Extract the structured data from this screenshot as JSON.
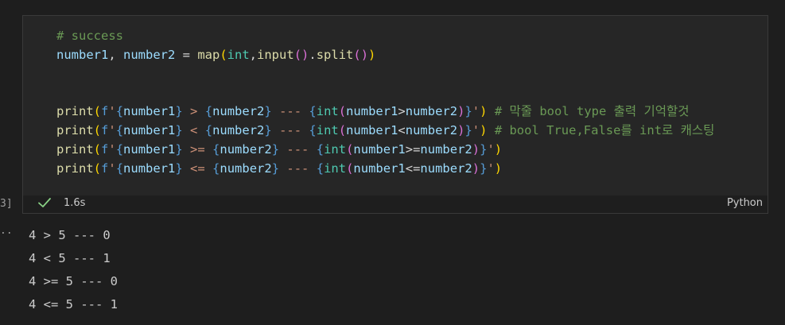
{
  "cell": {
    "execution_count": "3]",
    "language": "Python",
    "status": {
      "icon": "check-icon",
      "duration": "1.6s",
      "success_color": "#89d185"
    },
    "code": {
      "comment": "# success",
      "line2": {
        "vars": "number1, number2",
        "assign": " = ",
        "map": "map",
        "int": "int",
        "input": "input",
        "split": ".split",
        "parens": "())"
      },
      "print1_comment": "# 막줄 bool type 출력 기억할것",
      "print2_comment": "# bool True,False를 int로 캐스팅"
    }
  },
  "output": {
    "prompt": "..",
    "lines": [
      "4 > 5 --- 0",
      "4 < 5 --- 1",
      "4 >= 5 --- 0",
      "4 <= 5 --- 1"
    ]
  }
}
